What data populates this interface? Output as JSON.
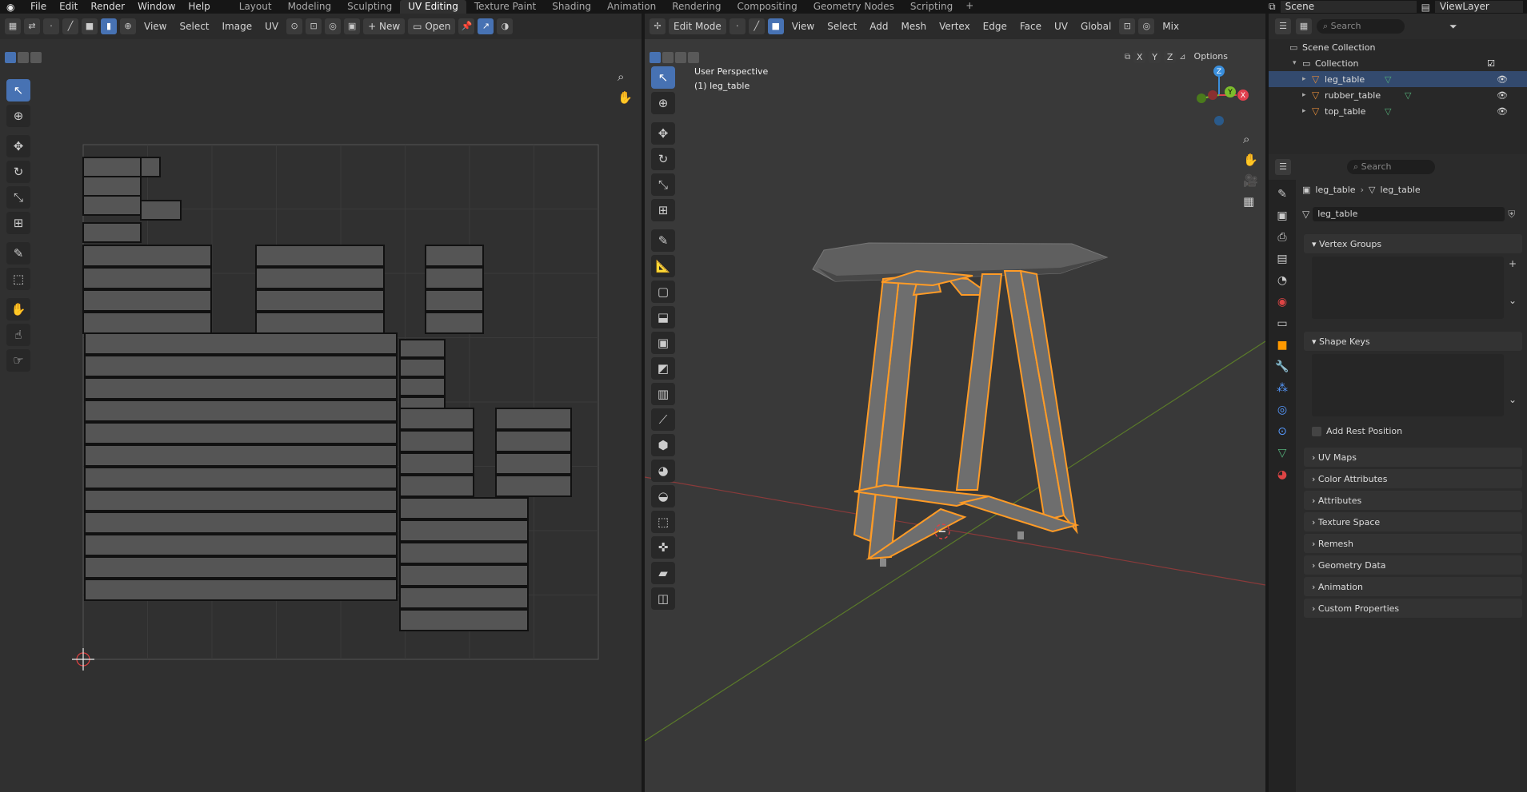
{
  "topbar": {
    "menus": [
      "File",
      "Edit",
      "Render",
      "Window",
      "Help"
    ],
    "workspaces": [
      "Layout",
      "Modeling",
      "Sculpting",
      "UV Editing",
      "Texture Paint",
      "Shading",
      "Animation",
      "Rendering",
      "Compositing",
      "Geometry Nodes",
      "Scripting"
    ],
    "active_workspace": "UV Editing",
    "scene": "Scene",
    "view_layer": "ViewLayer"
  },
  "uv_editor": {
    "menus": [
      "View",
      "Select",
      "Image",
      "UV"
    ],
    "new_label": "New",
    "open_label": "Open"
  },
  "viewport": {
    "mode": "Edit Mode",
    "menus": [
      "View",
      "Select",
      "Add",
      "Mesh",
      "Vertex",
      "Edge",
      "Face",
      "UV"
    ],
    "transform": "Global",
    "overlay": "Mix",
    "options": "Options",
    "axes": [
      "X",
      "Y",
      "Z"
    ],
    "info_line1": "User Perspective",
    "info_line2": "(1) leg_table",
    "gizmo": [
      "Z",
      "Y",
      "X"
    ]
  },
  "outliner": {
    "search_placeholder": "Search",
    "root": "Scene Collection",
    "collection": "Collection",
    "objects": [
      "leg_table",
      "rubber_table",
      "top_table"
    ]
  },
  "properties": {
    "search_placeholder": "Search",
    "breadcrumb_object": "leg_table",
    "breadcrumb_data": "leg_table",
    "mesh_name": "leg_table",
    "panels": [
      "Vertex Groups",
      "Shape Keys"
    ],
    "add_rest_position": "Add Rest Position",
    "collapsed_panels": [
      "UV Maps",
      "Color Attributes",
      "Attributes",
      "Texture Space",
      "Remesh",
      "Geometry Data",
      "Animation",
      "Custom Properties"
    ]
  },
  "colors": {
    "accent": "#4772b3",
    "selection": "#ff9b26",
    "x_axis": "#e0404e",
    "y_axis": "#7cbc2c",
    "z_axis": "#3a8fdd"
  }
}
